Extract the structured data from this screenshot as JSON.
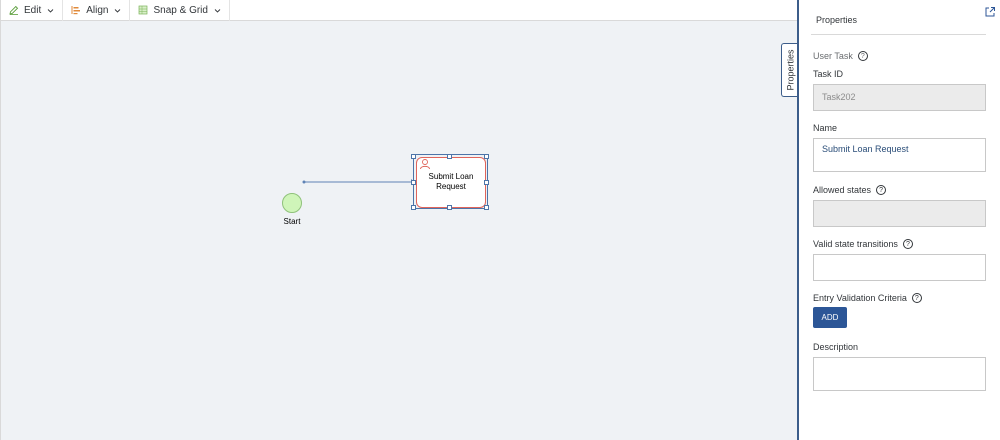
{
  "toolbar": {
    "edit_label": "Edit",
    "align_label": "Align",
    "snap_label": "Snap & Grid"
  },
  "diagram": {
    "start_label": "Start",
    "task_label_line1": "Submit Loan",
    "task_label_line2": "Request"
  },
  "panel": {
    "title": "Properties",
    "side_tab": "Properties",
    "type_label": "User Task",
    "task_id_label": "Task ID",
    "task_id_value": "Task202",
    "name_label": "Name",
    "name_value": "Submit Loan Request",
    "allowed_states_label": "Allowed states",
    "allowed_states_value": "",
    "transitions_label": "Valid state transitions",
    "transitions_value": "",
    "entry_validation_label": "Entry Validation Criteria",
    "add_button": "ADD",
    "description_label": "Description",
    "description_value": "",
    "help_glyph": "?"
  },
  "colors": {
    "accent": "#2c5697",
    "canvas": "#eff2f5",
    "start_fill": "#cff5b9",
    "task_border": "#e0655b"
  },
  "icons": {
    "edit": "pencil-icon",
    "align": "align-left-icon",
    "snap": "grid-icon",
    "task": "user-task-icon",
    "export": "open-external-icon"
  }
}
